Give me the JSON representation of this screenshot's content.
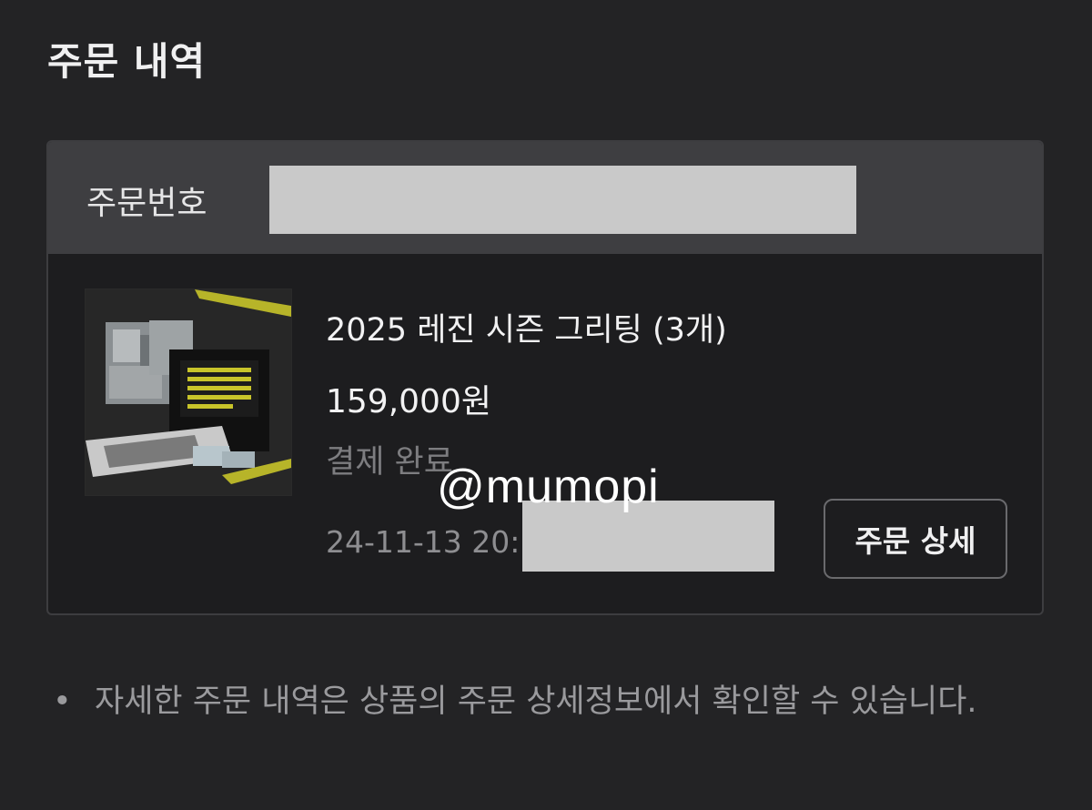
{
  "page": {
    "title": "주문 내역"
  },
  "order": {
    "number_label": "주문번호",
    "product": {
      "name": "2025 레진 시즌 그리팅 (3개)",
      "price": "159,000원",
      "payment_status": "결제 완료",
      "date": "24-11-13 20:"
    },
    "detail_button_label": "주문 상세"
  },
  "watermark": "@mumopi",
  "notice": {
    "bullet": "•",
    "text": "자세한 주문 내역은 상품의 주문 상세정보에서 확인할 수 있습니다."
  },
  "colors": {
    "background": "#232325",
    "card_header": "#3e3e41",
    "card_body": "#1d1d1f",
    "redaction": "#c9c9c9",
    "accent_yellow": "#c8c42a"
  }
}
